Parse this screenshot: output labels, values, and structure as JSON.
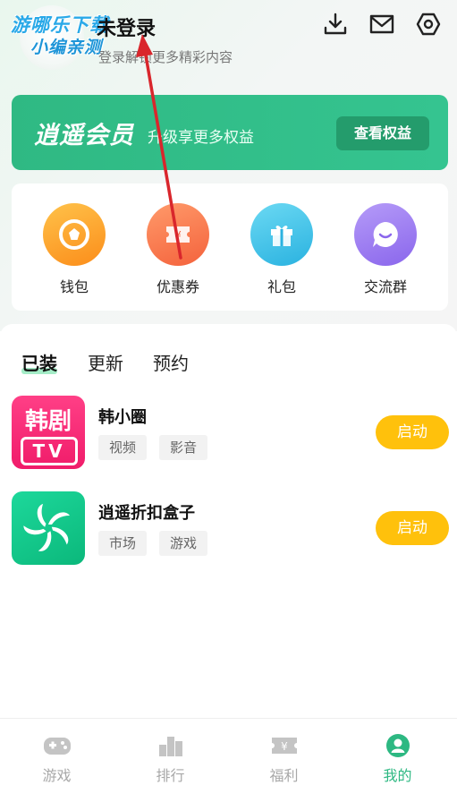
{
  "header": {
    "watermark_line1": "游哪乐下载",
    "watermark_line2": "小编亲测",
    "login_title": "未登录",
    "login_subtitle": "登录解锁更多精彩内容",
    "icons": [
      "download-icon",
      "mail-icon",
      "settings-icon"
    ]
  },
  "vip": {
    "title": "逍遥会员",
    "subtitle": "升级享更多权益",
    "button": "查看权益",
    "color": "#2fb983"
  },
  "quick_links": [
    {
      "label": "钱包",
      "icon": "wallet-icon",
      "color": "#fda22a"
    },
    {
      "label": "优惠券",
      "icon": "coupon-icon",
      "color": "#fb7a51"
    },
    {
      "label": "礼包",
      "icon": "gift-icon",
      "color": "#3fc2e8"
    },
    {
      "label": "交流群",
      "icon": "chat-icon",
      "color": "#9c7cf0"
    }
  ],
  "tabs": [
    {
      "label": "已装",
      "active": true
    },
    {
      "label": "更新",
      "active": false
    },
    {
      "label": "预约",
      "active": false
    }
  ],
  "apps": [
    {
      "name": "韩小圈",
      "tags": [
        "视频",
        "影音"
      ],
      "button": "启动",
      "icon": "hanju-tv-app-icon",
      "icon_text_top": "韩剧",
      "icon_text_bottom": "TV"
    },
    {
      "name": "逍遥折扣盒子",
      "tags": [
        "市场",
        "游戏"
      ],
      "button": "启动",
      "icon": "xiaoyao-discount-app-icon"
    }
  ],
  "bottom_nav": [
    {
      "label": "游戏",
      "icon": "gamepad-icon",
      "active": false
    },
    {
      "label": "排行",
      "icon": "ranking-icon",
      "active": false
    },
    {
      "label": "福利",
      "icon": "welfare-ticket-icon",
      "active": false
    },
    {
      "label": "我的",
      "icon": "profile-icon",
      "active": true
    }
  ],
  "colors": {
    "accent": "#2db882",
    "launch_button": "#ffc10c",
    "annotation_arrow": "#d9262c"
  }
}
